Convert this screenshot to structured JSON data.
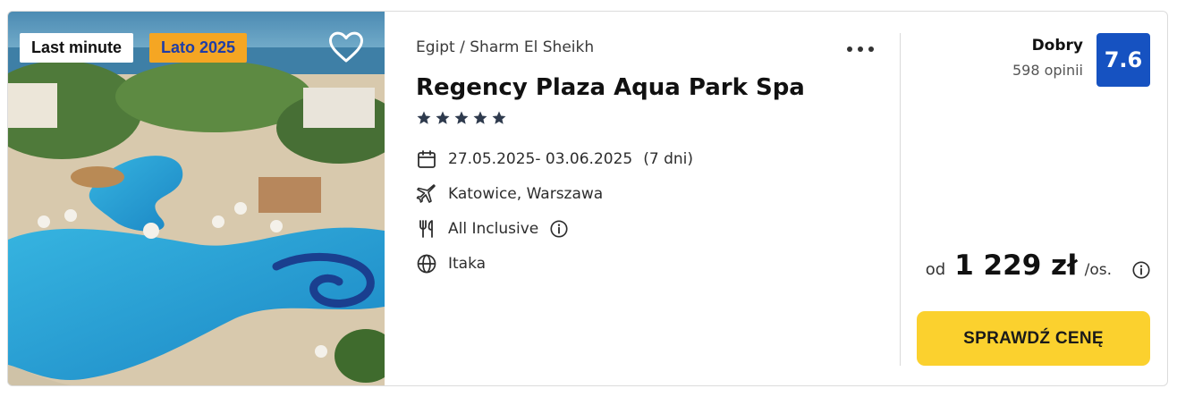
{
  "photo": {
    "badges": {
      "last_minute": "Last minute",
      "season": "Lato 2025"
    },
    "favorite_icon": "heart-outline-icon"
  },
  "hotel": {
    "location": "Egipt / Sharm El Sheikh",
    "name": "Regency Plaza Aqua Park Spa",
    "stars": 5,
    "dates": "27.05.2025- 03.06.2025",
    "duration": "(7 dni)",
    "departure": "Katowice, Warszawa",
    "board": "All Inclusive",
    "operator": "Itaka"
  },
  "rating": {
    "label": "Dobry",
    "count": "598 opinii",
    "score": "7.6"
  },
  "price": {
    "prefix": "od",
    "amount": "1 229 zł",
    "suffix": "/os."
  },
  "cta": {
    "label": "SPRAWDŹ CENĘ"
  },
  "colors": {
    "score_bg": "#1652c1",
    "cta_bg": "#fbd12e",
    "season_badge_bg": "#f5a623",
    "season_badge_text": "#1f3da6",
    "stars": "#2e3a4d"
  }
}
